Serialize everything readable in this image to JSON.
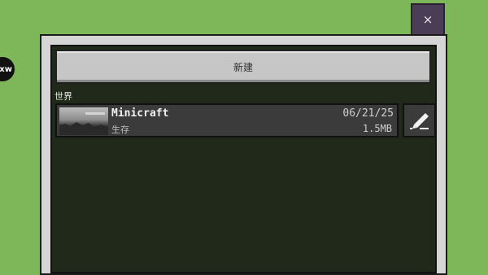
{
  "close": {
    "label": "×"
  },
  "avatar": {
    "text": "xw"
  },
  "new_button": {
    "label": "新建"
  },
  "section": {
    "label": "世界"
  },
  "worlds": [
    {
      "name": "Minicraft",
      "mode": "生存",
      "date": "06/21/25",
      "size": "1.5MB"
    }
  ],
  "icons": {
    "edit": "pencil-icon",
    "close": "close-icon"
  }
}
